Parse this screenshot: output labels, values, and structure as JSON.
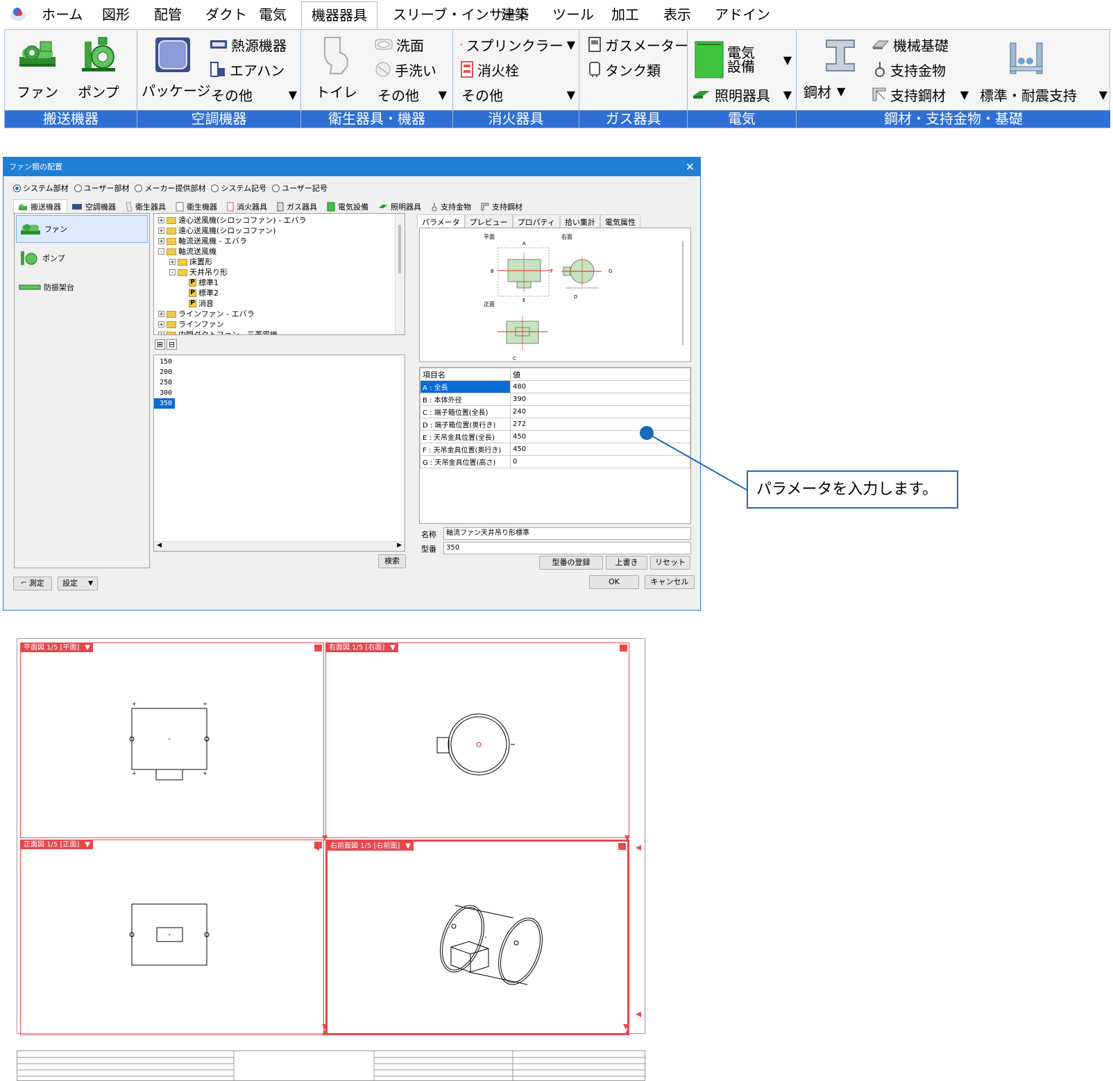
{
  "menubar": {
    "tabs": [
      "ホーム",
      "図形",
      "配管",
      "ダクト",
      "電気",
      "機器器具",
      "スリーブ・インサート",
      "建築",
      "ツール",
      "加工",
      "表示",
      "アドイン"
    ],
    "active_tab": "機器器具"
  },
  "ribbon": {
    "groups": {
      "transport": {
        "label": "搬送機器",
        "fan": "ファン",
        "pump": "ポンプ"
      },
      "hvac": {
        "label": "空調機器",
        "package": "パッケージ",
        "heat_source": "熱源機器",
        "air_handler": "エアハン",
        "other": "その他"
      },
      "sanitary": {
        "label": "衛生器具・機器",
        "toilet": "トイレ",
        "washbasin": "洗面",
        "handwash": "手洗い",
        "other": "その他"
      },
      "fire": {
        "label": "消火器具",
        "sprinkler": "スプリンクラー",
        "hydrant": "消火栓",
        "other": "その他"
      },
      "gas": {
        "label": "ガス器具",
        "meter": "ガスメーター",
        "tank": "タンク類"
      },
      "electric": {
        "label": "電気",
        "equipment": "電気\n設備",
        "lighting": "照明器具"
      },
      "steel": {
        "label": "鋼材・支持金物・基礎",
        "steel": "鋼材",
        "foundation": "機械基礎",
        "support_hardware": "支持金物",
        "support_steel": "支持鋼材",
        "seismic": "標準・耐震支持"
      }
    }
  },
  "dialog": {
    "title": "ファン類の配置",
    "source_options": [
      "システム部材",
      "ユーザー部材",
      "メーカー提供部材",
      "システム記号",
      "ユーザー記号"
    ],
    "selected_source": "システム部材",
    "category_tabs": [
      "搬送機器",
      "空調機器",
      "衛生器具",
      "衛生機器",
      "消火器具",
      "ガス器具",
      "電気設備",
      "照明器具",
      "支持金物",
      "支持鋼材"
    ],
    "left_items": [
      "ファン",
      "ポンプ",
      "防振架台"
    ],
    "tree": [
      {
        "label": "遠心送風機(シロッコファン) - エバラ",
        "level": 0,
        "type": "folder",
        "exp": "+"
      },
      {
        "label": "遠心送風機(シロッコファン)",
        "level": 0,
        "type": "folder",
        "exp": "+"
      },
      {
        "label": "軸流送風機 - エバラ",
        "level": 0,
        "type": "folder",
        "exp": "+"
      },
      {
        "label": "軸流送風機",
        "level": 0,
        "type": "folder",
        "exp": "-"
      },
      {
        "label": "床置形",
        "level": 1,
        "type": "folder",
        "exp": "+"
      },
      {
        "label": "天井吊り形",
        "level": 1,
        "type": "folder",
        "exp": "-"
      },
      {
        "label": "標準1",
        "level": 2,
        "type": "part",
        "exp": ""
      },
      {
        "label": "標準2",
        "level": 2,
        "type": "part",
        "exp": ""
      },
      {
        "label": "消音",
        "level": 2,
        "type": "part",
        "exp": ""
      },
      {
        "label": "ラインファン - エバラ",
        "level": 0,
        "type": "folder",
        "exp": "+"
      },
      {
        "label": "ラインファン",
        "level": 0,
        "type": "folder",
        "exp": "+"
      },
      {
        "label": "中間ダクトファン - 三菱電機",
        "level": 0,
        "type": "folder",
        "exp": "+"
      }
    ],
    "expand_all": "⊞",
    "collapse_all": "⊟",
    "sizes": [
      "150",
      "200",
      "250",
      "300",
      "350"
    ],
    "selected_size": "350",
    "search_button": "検索",
    "param_tabs": [
      "パラメータ",
      "プレビュー",
      "プロパティ",
      "拾い集計",
      "電気属性"
    ],
    "preview_labels": {
      "plan": "平面",
      "right": "右面",
      "front": "正面",
      "A": "A",
      "B": "B",
      "C": "C",
      "D": "D",
      "E": "E",
      "F": "F",
      "G": "G"
    },
    "params_header": {
      "name": "項目名",
      "value": "値"
    },
    "params": [
      {
        "name": "A : 全長",
        "value": "480"
      },
      {
        "name": "B : 本体外径",
        "value": "390"
      },
      {
        "name": "C : 端子箱位置(全長)",
        "value": "240"
      },
      {
        "name": "D : 端子箱位置(奥行き)",
        "value": "272"
      },
      {
        "name": "E : 天吊金具位置(全長)",
        "value": "450"
      },
      {
        "name": "F : 天吊金具位置(奥行き)",
        "value": "450"
      },
      {
        "name": "G : 天吊金具位置(高さ)",
        "value": "0"
      }
    ],
    "name_label": "名称",
    "name_value": "軸流ファン天井吊り形標準",
    "model_label": "型番",
    "model_value": "350",
    "register_button": "型番の登録",
    "overwrite_button": "上書き",
    "reset_button": "リセット",
    "measure_button": "測定",
    "settings_button": "設定",
    "ok_button": "OK",
    "cancel_button": "キャンセル"
  },
  "callout": "パラメータを入力します。",
  "cad": {
    "viewports": [
      {
        "title": "平面図 1/5 [平面]"
      },
      {
        "title": "右面図 1/5 [右面]"
      },
      {
        "title": "正面図 1/5 [正面]"
      },
      {
        "title": "右前面図 1/5 [右前面]"
      }
    ]
  },
  "colors": {
    "ribbon_group": "#2f6fd4",
    "titlebar": "#1f7fd6",
    "viewport_red": "#e5484d",
    "callout_border": "#1a6ab8",
    "select_blue": "#0a6ad6"
  }
}
